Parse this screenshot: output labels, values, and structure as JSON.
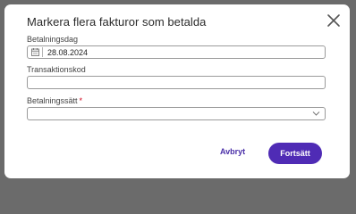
{
  "dialog": {
    "title": "Markera flera fakturor som betalda"
  },
  "form": {
    "payment_date": {
      "label": "Betalningsdag",
      "value": "28.08.2024"
    },
    "transaction_code": {
      "label": "Transaktionskod",
      "value": ""
    },
    "payment_method": {
      "label": "Betalningssätt",
      "required_mark": "*",
      "value": ""
    }
  },
  "actions": {
    "cancel_label": "Avbryt",
    "continue_label": "Fortsätt"
  },
  "icons": {
    "close": "close-icon",
    "calendar": "calendar-icon",
    "dropdown": "chevron-down-icon"
  },
  "colors": {
    "primary": "#4f2bb5",
    "link": "#4a2fa8",
    "required": "#d0021b",
    "overlay": "#6b6b6b"
  }
}
